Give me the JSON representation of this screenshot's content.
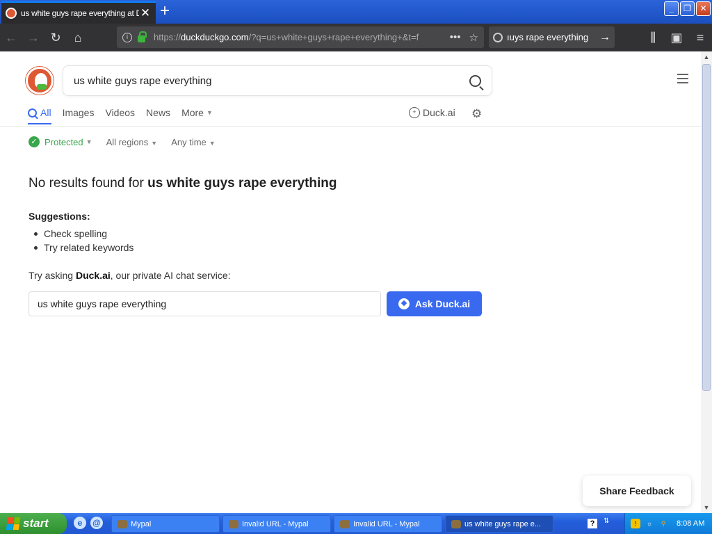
{
  "browser": {
    "tab_title": "us white guys rape everything at DuckDuckGo",
    "tab_close": "✕",
    "new_tab": "+",
    "url_prefix": "https://",
    "url_host": "duckduckgo.com",
    "url_rest": "/?q=us+white+guys+rape+everything+&t=f",
    "search_text": "ıuys rape everything",
    "window_min": "_",
    "window_max": "❐",
    "window_close": "✕"
  },
  "page": {
    "search_query": "us white guys rape everything",
    "tabs": [
      {
        "label": "All"
      },
      {
        "label": "Images"
      },
      {
        "label": "Videos"
      },
      {
        "label": "News"
      },
      {
        "label": "More"
      }
    ],
    "duckai_label": "Duck.ai",
    "filters": {
      "protected": "Protected",
      "regions": "All regions",
      "time": "Any time"
    },
    "no_results_prefix": "No results found for ",
    "no_results_query": "us white guys rape everything",
    "suggestions_title": "Suggestions:",
    "suggestions": [
      "Check spelling",
      "Try related keywords"
    ],
    "try_prefix": "Try asking ",
    "try_brand": "Duck.ai",
    "try_suffix": ", our private AI chat service:",
    "ask_input_value": "us white guys rape everything",
    "ask_button": "Ask Duck.ai",
    "feedback": "Share Feedback"
  },
  "taskbar": {
    "start": "start",
    "tasks": [
      {
        "label": "Mypal"
      },
      {
        "label": "Invalid URL - Mypal"
      },
      {
        "label": "Invalid URL - Mypal"
      },
      {
        "label": "us white guys rape e..."
      }
    ],
    "clock": "8:08 AM"
  },
  "colors": {
    "accent": "#3969ef",
    "ddg_orange": "#de5833",
    "protected_green": "#3aa64c"
  }
}
